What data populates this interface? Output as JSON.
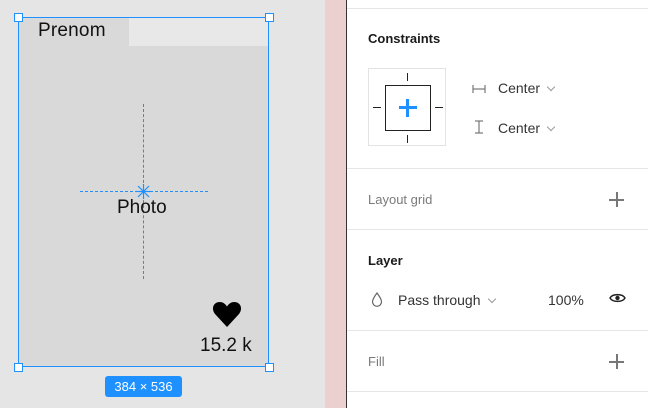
{
  "canvas": {
    "card_name": "Prenom",
    "photo_label": "Photo",
    "like_count": "15.2 k",
    "dimensions": "384 × 536"
  },
  "panel": {
    "constraints": {
      "title": "Constraints",
      "horizontal": "Center",
      "vertical": "Center"
    },
    "layout_grid": {
      "title": "Layout grid"
    },
    "layer": {
      "title": "Layer",
      "blend_mode": "Pass through",
      "opacity": "100%"
    },
    "fill": {
      "title": "Fill"
    }
  },
  "colors": {
    "selection": "#1e90ff",
    "frame_fill": "#d9d9d9",
    "canvas_bg": "#e5e5e5"
  }
}
